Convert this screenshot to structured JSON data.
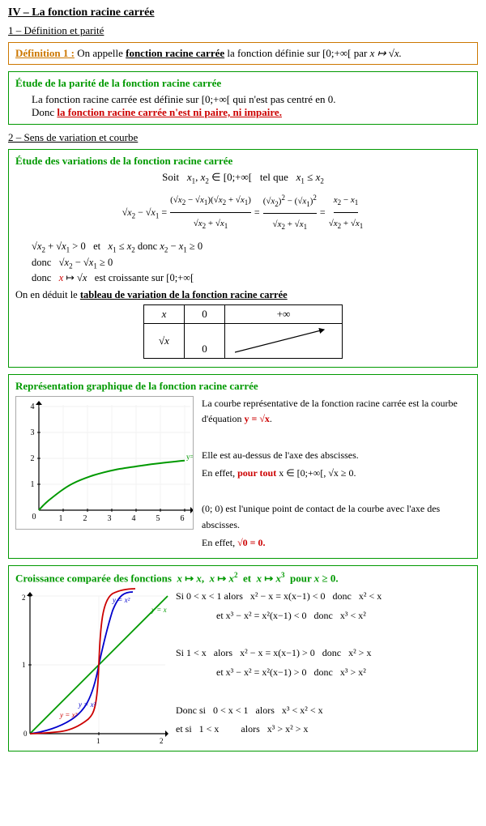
{
  "title": "IV – La fonction racine carrée",
  "section1": "1 – Définition et parité",
  "definition": {
    "label": "Définition 1 :",
    "text_before": "On appelle ",
    "keyword": "fonction racine carrée",
    "text_after": " la fonction définie sur ",
    "domain": "[0;+∞[",
    "by": " par ",
    "mapping": "x ↦ √x."
  },
  "parity_box": {
    "title": "Étude de la parité de la fonction racine carrée",
    "line1": "La fonction racine carrée est définie sur [0;+∞[  qui n'est pas centré en 0.",
    "line2": "Donc ",
    "line2_red": "la fonction racine carrée n'est ni paire, ni impaire."
  },
  "section2": "2 – Sens de variation et courbe",
  "variation_box": {
    "title": "Étude des variations de la fonction racine carrée",
    "line1": "Soit  x₁, x₂ ∈ [0;+∞[  tel que  x₁ ≤ x₂"
  },
  "variation_table": {
    "headers": [
      "x",
      "0",
      "+∞"
    ],
    "row_label": "√x",
    "row_value": "0"
  },
  "graph_box": {
    "title": "Représentation graphique de la fonction racine carrée",
    "desc1": "La courbe représentative de la fonction racine carrée est la courbe d'équation ",
    "eq": "y = √x",
    "desc2": ".",
    "desc3": "Elle est au-dessus de l'axe des abscisses.",
    "desc4": "En effet, ",
    "desc4_red": "pour tout",
    "desc4_cont": " x ∈ [0;+∞[, √x ≥ 0.",
    "desc5": "(0; 0) est l'unique point de contact de la courbe avec l'axe des abscisses.",
    "desc6": "En effet, ",
    "desc6_red": "√0 = 0."
  },
  "compare_box": {
    "title": "Croissance comparée des fonctions  x ↦ x,  x ↦ x²  et  x ↦ x³  pour x ≥ 0.",
    "lines": [
      "Si 0 < x < 1 alors  x² − x = x(x−1) < 0  donc  x² < x",
      "            et x³ − x² = x²(x−1) < 0  donc  x³ < x²",
      "Si 1 < x  alors  x² − x = x(x−1) > 0  donc  x² > x",
      "            et x³ − x² = x²(x−1) > 0  donc  x³ > x²",
      "",
      "Donc si  0 < x < 1  alors  x³ < x² < x",
      "      et si  1 < x       alors  x³ > x² > x"
    ]
  }
}
